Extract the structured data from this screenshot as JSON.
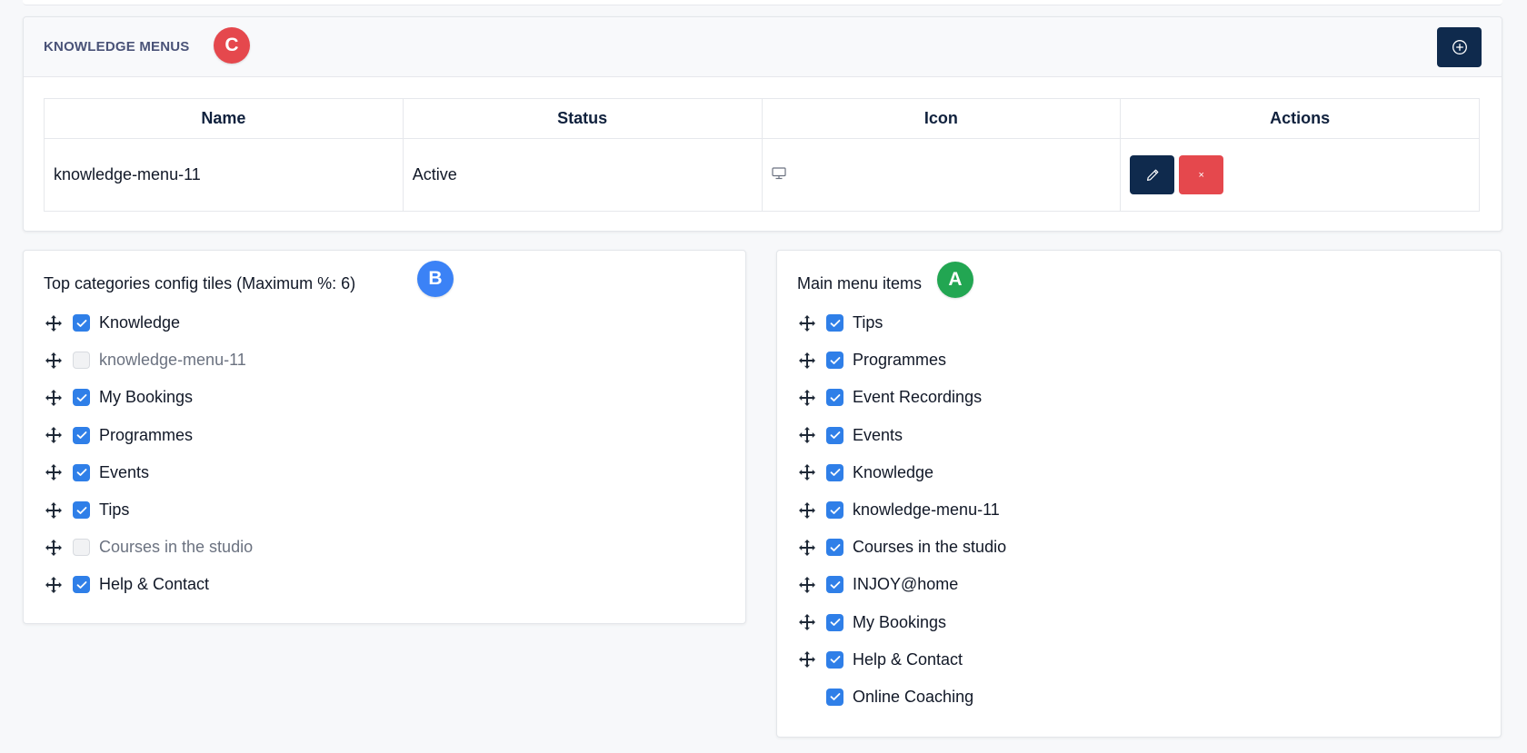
{
  "menus_panel": {
    "title": "KNOWLEDGE MENUS",
    "badge": "C",
    "add_icon": "plus-circle-icon",
    "columns": [
      "Name",
      "Status",
      "Icon",
      "Actions"
    ],
    "rows": [
      {
        "name": "knowledge-menu-11",
        "status": "Active",
        "icon": "monitor-icon",
        "edit_icon": "pencil-icon",
        "delete_label": "×"
      }
    ]
  },
  "tiles_panel": {
    "label": "Top categories config tiles (Maximum %: 6)",
    "badge": "B",
    "items": [
      {
        "label": "Knowledge",
        "checked": true
      },
      {
        "label": "knowledge-menu-11",
        "checked": false
      },
      {
        "label": "My Bookings",
        "checked": true
      },
      {
        "label": "Programmes",
        "checked": true
      },
      {
        "label": "Events",
        "checked": true
      },
      {
        "label": "Tips",
        "checked": true
      },
      {
        "label": "Courses in the studio",
        "checked": false
      },
      {
        "label": "Help & Contact",
        "checked": true
      }
    ]
  },
  "main_menu_panel": {
    "label": "Main menu items",
    "badge": "A",
    "items": [
      {
        "label": "Tips",
        "checked": true,
        "draggable": true
      },
      {
        "label": "Programmes",
        "checked": true,
        "draggable": true
      },
      {
        "label": "Event Recordings",
        "checked": true,
        "draggable": true
      },
      {
        "label": "Events",
        "checked": true,
        "draggable": true
      },
      {
        "label": "Knowledge",
        "checked": true,
        "draggable": true
      },
      {
        "label": "knowledge-menu-11",
        "checked": true,
        "draggable": true
      },
      {
        "label": "Courses in the studio",
        "checked": true,
        "draggable": true
      },
      {
        "label": "INJOY@home",
        "checked": true,
        "draggable": true
      },
      {
        "label": "My Bookings",
        "checked": true,
        "draggable": true
      },
      {
        "label": "Help & Contact",
        "checked": true,
        "draggable": true
      },
      {
        "label": "Online Coaching",
        "checked": true,
        "draggable": false
      }
    ]
  },
  "colors": {
    "primary": "#0f2a4d",
    "danger": "#e5484d",
    "checkbox": "#2f7fe8",
    "badge_a": "#22a652",
    "badge_b": "#3b82f6",
    "badge_c": "#e5484d"
  }
}
